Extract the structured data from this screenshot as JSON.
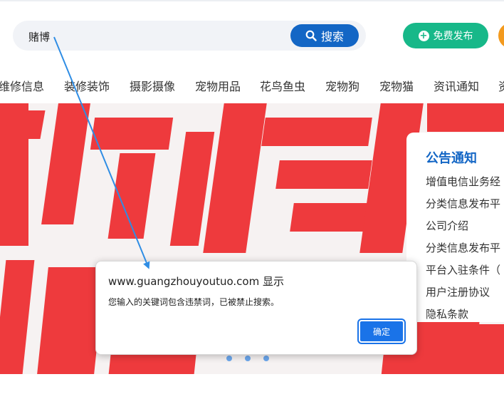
{
  "search": {
    "value": "赌博",
    "button_label": "搜索"
  },
  "header": {
    "publish_label": "免费发布"
  },
  "nav": {
    "items": [
      "维修信息",
      "装修装饰",
      "摄影摄像",
      "宠物用品",
      "花鸟鱼虫",
      "宠物狗",
      "宠物猫",
      "资讯通知",
      "资"
    ]
  },
  "notice": {
    "title": "公告通知",
    "items": [
      "增值电信业务经",
      "分类信息发布平",
      "公司介绍",
      "分类信息发布平",
      "平台入驻条件（",
      "用户注册协议",
      "隐私条款"
    ]
  },
  "dialog": {
    "title": "www.guangzhouyoutuo.com 显示",
    "message": "您输入的关键词包含违禁词，已被禁止搜索。",
    "ok_label": "确定"
  },
  "colors": {
    "brand_blue": "#1366c5",
    "publish_green": "#17b889",
    "banner_red": "#ee3a3d",
    "dialog_button": "#1a73e8"
  }
}
